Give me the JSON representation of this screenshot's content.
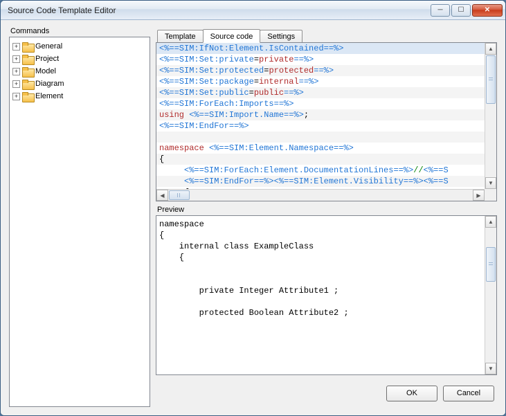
{
  "window": {
    "title": "Source Code Template Editor"
  },
  "commands": {
    "label": "Commands",
    "items": [
      {
        "label": "General"
      },
      {
        "label": "Project"
      },
      {
        "label": "Model"
      },
      {
        "label": "Diagram"
      },
      {
        "label": "Element"
      }
    ]
  },
  "tabs": [
    {
      "label": "Template"
    },
    {
      "label": "Source code"
    },
    {
      "label": "Settings"
    }
  ],
  "active_tab": "Source code",
  "code_lines": [
    {
      "sel": true,
      "segs": [
        {
          "c": "tag",
          "t": "<%==SIM:IfNot:Element.IsContained==%>"
        }
      ]
    },
    {
      "sel": false,
      "segs": [
        {
          "c": "tag",
          "t": "<%==SIM:Set:private"
        },
        {
          "c": "txt",
          "t": "="
        },
        {
          "c": "kw",
          "t": "private"
        },
        {
          "c": "tag",
          "t": "==%>"
        }
      ]
    },
    {
      "sel": false,
      "alt": true,
      "segs": [
        {
          "c": "tag",
          "t": "<%==SIM:Set:protected"
        },
        {
          "c": "txt",
          "t": "="
        },
        {
          "c": "kw",
          "t": "protected"
        },
        {
          "c": "tag",
          "t": "==%>"
        }
      ]
    },
    {
      "sel": false,
      "segs": [
        {
          "c": "tag",
          "t": "<%==SIM:Set:package"
        },
        {
          "c": "txt",
          "t": "="
        },
        {
          "c": "kw",
          "t": "internal"
        },
        {
          "c": "tag",
          "t": "==%>"
        }
      ]
    },
    {
      "sel": false,
      "alt": true,
      "segs": [
        {
          "c": "tag",
          "t": "<%==SIM:Set:public"
        },
        {
          "c": "txt",
          "t": "="
        },
        {
          "c": "kw",
          "t": "public"
        },
        {
          "c": "tag",
          "t": "==%>"
        }
      ]
    },
    {
      "sel": false,
      "segs": [
        {
          "c": "tag",
          "t": "<%==SIM:ForEach:Imports==%>"
        }
      ]
    },
    {
      "sel": false,
      "alt": true,
      "segs": [
        {
          "c": "kw",
          "t": "using "
        },
        {
          "c": "tag",
          "t": "<%==SIM:Import.Name==%>"
        },
        {
          "c": "txt",
          "t": ";"
        }
      ]
    },
    {
      "sel": false,
      "segs": [
        {
          "c": "tag",
          "t": "<%==SIM:EndFor==%>"
        }
      ]
    },
    {
      "sel": false,
      "alt": true,
      "segs": [
        {
          "c": "txt",
          "t": " "
        }
      ]
    },
    {
      "sel": false,
      "segs": [
        {
          "c": "kw",
          "t": "namespace "
        },
        {
          "c": "tag",
          "t": "<%==SIM:Element.Namespace==%>"
        }
      ]
    },
    {
      "sel": false,
      "alt": true,
      "segs": [
        {
          "c": "txt",
          "t": "{"
        }
      ]
    },
    {
      "sel": false,
      "indent": 1,
      "segs": [
        {
          "c": "tag",
          "t": "<%==SIM:ForEach:Element.DocumentationLines==%>"
        },
        {
          "c": "str",
          "t": "//"
        },
        {
          "c": "tag",
          "t": "<%==S"
        }
      ]
    },
    {
      "sel": false,
      "alt": true,
      "indent": 1,
      "segs": [
        {
          "c": "tag",
          "t": "<%==SIM:EndFor==%><%==SIM:Element.Visibility==%>"
        },
        {
          "c": "tag",
          "t": "<%==S"
        }
      ]
    },
    {
      "sel": false,
      "indent": 1,
      "segs": [
        {
          "c": "txt",
          "t": "{"
        }
      ]
    }
  ],
  "preview": {
    "label": "Preview",
    "text": "namespace\n{\n    internal class ExampleClass\n    {\n\n\n        private Integer Attribute1 ;\n\n        protected Boolean Attribute2 ;\n"
  },
  "buttons": {
    "ok": "OK",
    "cancel": "Cancel"
  }
}
